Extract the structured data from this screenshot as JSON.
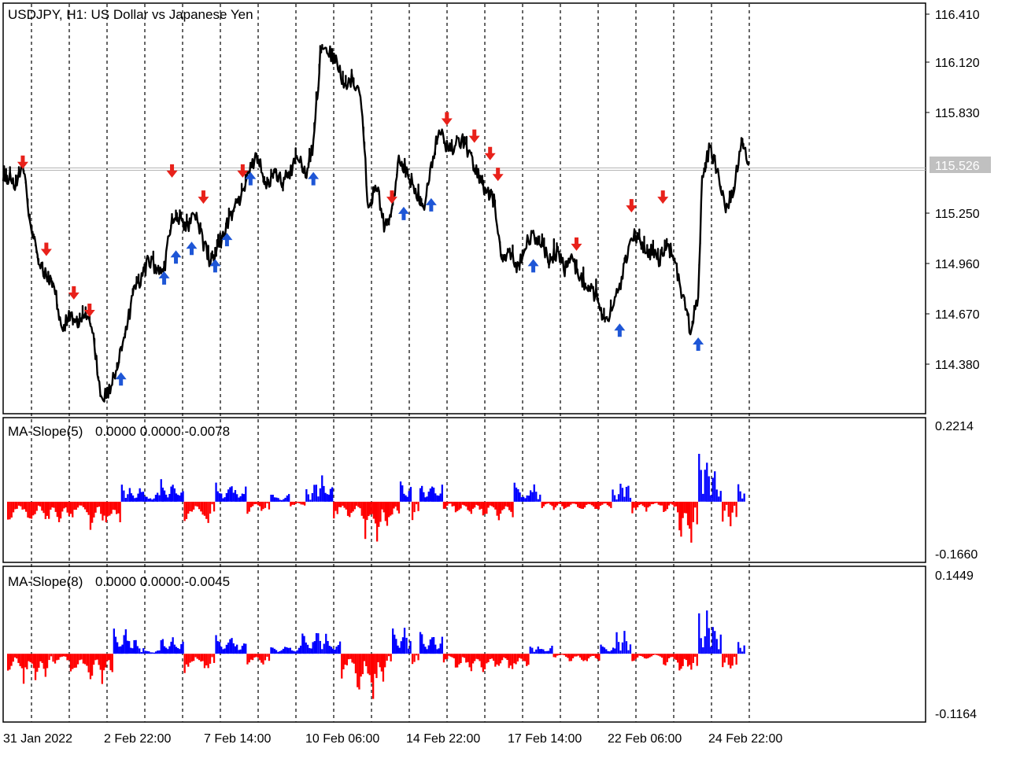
{
  "chart_data": {
    "type": "line",
    "title": "USDJPY, H1:  US Dollar vs  Japanese Yen",
    "x_tick_labels": [
      "31 Jan 2022",
      "2 Feb 22:00",
      "7 Feb 14:00",
      "10 Feb 06:00",
      "14 Feb 22:00",
      "17 Feb 14:00",
      "22 Feb 06:00",
      "24 Feb 22:00"
    ],
    "x_range": [
      0,
      190
    ],
    "price_panel": {
      "y_tick_labels": [
        "116.410",
        "116.120",
        "115.830",
        "115.250",
        "114.960",
        "114.670",
        "114.380"
      ],
      "ylim": [
        114.13,
        116.47
      ],
      "current_price": "115.526",
      "current_price_value": 115.526,
      "close": [
        [
          0,
          115.5
        ],
        [
          3,
          115.45
        ],
        [
          5,
          115.55
        ],
        [
          7,
          115.2
        ],
        [
          9,
          115.0
        ],
        [
          11,
          114.9
        ],
        [
          13,
          114.85
        ],
        [
          15,
          114.6
        ],
        [
          17,
          114.7
        ],
        [
          19,
          114.65
        ],
        [
          21,
          114.7
        ],
        [
          23,
          114.55
        ],
        [
          25,
          114.2
        ],
        [
          27,
          114.25
        ],
        [
          29,
          114.4
        ],
        [
          31,
          114.55
        ],
        [
          33,
          114.8
        ],
        [
          35,
          114.9
        ],
        [
          37,
          115.0
        ],
        [
          39,
          114.95
        ],
        [
          41,
          114.95
        ],
        [
          43,
          115.25
        ],
        [
          45,
          115.25
        ],
        [
          47,
          115.2
        ],
        [
          49,
          115.25
        ],
        [
          51,
          115.1
        ],
        [
          53,
          114.98
        ],
        [
          55,
          115.1
        ],
        [
          57,
          115.2
        ],
        [
          59,
          115.3
        ],
        [
          61,
          115.4
        ],
        [
          63,
          115.55
        ],
        [
          65,
          115.6
        ],
        [
          67,
          115.4
        ],
        [
          69,
          115.5
        ],
        [
          71,
          115.45
        ],
        [
          73,
          115.5
        ],
        [
          75,
          115.6
        ],
        [
          77,
          115.5
        ],
        [
          79,
          115.65
        ],
        [
          81,
          116.25
        ],
        [
          83,
          116.2
        ],
        [
          85,
          116.15
        ],
        [
          87,
          116.0
        ],
        [
          89,
          116.05
        ],
        [
          91,
          115.95
        ],
        [
          93,
          115.3
        ],
        [
          95,
          115.45
        ],
        [
          97,
          115.2
        ],
        [
          99,
          115.3
        ],
        [
          101,
          115.6
        ],
        [
          103,
          115.5
        ],
        [
          105,
          115.4
        ],
        [
          107,
          115.3
        ],
        [
          109,
          115.55
        ],
        [
          111,
          115.75
        ],
        [
          113,
          115.65
        ],
        [
          115,
          115.65
        ],
        [
          117,
          115.7
        ],
        [
          119,
          115.6
        ],
        [
          121,
          115.5
        ],
        [
          123,
          115.4
        ],
        [
          125,
          115.35
        ],
        [
          127,
          115.0
        ],
        [
          129,
          115.05
        ],
        [
          131,
          114.95
        ],
        [
          133,
          115.1
        ],
        [
          135,
          115.15
        ],
        [
          137,
          115.1
        ],
        [
          139,
          115.0
        ],
        [
          141,
          115.05
        ],
        [
          143,
          114.95
        ],
        [
          145,
          115.0
        ],
        [
          147,
          114.9
        ],
        [
          149,
          114.85
        ],
        [
          151,
          114.8
        ],
        [
          153,
          114.65
        ],
        [
          155,
          114.7
        ],
        [
          157,
          114.85
        ],
        [
          159,
          115.05
        ],
        [
          161,
          115.15
        ],
        [
          163,
          115.05
        ],
        [
          165,
          115.05
        ],
        [
          167,
          115.0
        ],
        [
          169,
          115.1
        ],
        [
          171,
          115.0
        ],
        [
          173,
          114.8
        ],
        [
          175,
          114.6
        ],
        [
          177,
          114.8
        ],
        [
          178,
          115.5
        ],
        [
          180,
          115.65
        ],
        [
          182,
          115.5
        ],
        [
          184,
          115.3
        ],
        [
          186,
          115.4
        ],
        [
          188,
          115.7
        ],
        [
          190,
          115.55
        ]
      ],
      "sell_signals": [
        [
          5,
          115.45
        ],
        [
          11,
          114.95
        ],
        [
          18,
          114.7
        ],
        [
          22,
          114.6
        ],
        [
          43,
          115.4
        ],
        [
          51,
          115.25
        ],
        [
          61,
          115.4
        ],
        [
          99,
          115.25
        ],
        [
          113,
          115.7
        ],
        [
          120,
          115.6
        ],
        [
          124,
          115.5
        ],
        [
          126,
          115.38
        ],
        [
          146,
          114.98
        ],
        [
          160,
          115.2
        ],
        [
          168,
          115.25
        ]
      ],
      "buy_signals": [
        [
          30,
          114.4
        ],
        [
          41,
          114.98
        ],
        [
          44,
          115.1
        ],
        [
          48,
          115.15
        ],
        [
          54,
          115.05
        ],
        [
          57,
          115.2
        ],
        [
          63,
          115.55
        ],
        [
          79,
          115.55
        ],
        [
          102,
          115.35
        ],
        [
          109,
          115.4
        ],
        [
          135,
          115.05
        ],
        [
          157,
          114.68
        ],
        [
          177,
          114.6
        ]
      ]
    },
    "indicators": [
      {
        "name": "MA-Slope(5)",
        "values_text": "0.0000 0.0000 -0.0078",
        "y_tick_labels": [
          "0.2214",
          "-0.1660"
        ],
        "ylim": [
          -0.166,
          0.2214
        ],
        "peaks": [
          [
            1,
            -0.03
          ],
          [
            7,
            -0.07
          ],
          [
            11,
            -0.04
          ],
          [
            14,
            -0.07
          ],
          [
            17,
            0.01
          ],
          [
            22,
            -0.06
          ],
          [
            26,
            -0.09
          ],
          [
            30,
            0.03
          ],
          [
            32,
            0.06
          ],
          [
            35,
            -0.01
          ],
          [
            40,
            0.04
          ],
          [
            43,
            0.07
          ],
          [
            46,
            -0.03
          ],
          [
            52,
            -0.07
          ],
          [
            54,
            0.02
          ],
          [
            58,
            0.06
          ],
          [
            62,
            0.04
          ],
          [
            66,
            -0.04
          ],
          [
            68,
            0.03
          ],
          [
            73,
            -0.02
          ],
          [
            77,
            0.01
          ],
          [
            79,
            0.05
          ],
          [
            81,
            0.09
          ],
          [
            84,
            -0.06
          ],
          [
            88,
            -0.02
          ],
          [
            92,
            -0.07
          ],
          [
            95,
            -0.13
          ],
          [
            98,
            -0.08
          ],
          [
            101,
            0.07
          ],
          [
            104,
            -0.06
          ],
          [
            106,
            -0.02
          ],
          [
            109,
            0.07
          ],
          [
            112,
            -0.03
          ],
          [
            115,
            0.01
          ],
          [
            119,
            -0.05
          ],
          [
            122,
            0.01
          ],
          [
            126,
            -0.06
          ],
          [
            130,
            -0.05
          ],
          [
            135,
            0.06
          ],
          [
            137,
            0.02
          ],
          [
            140,
            -0.02
          ],
          [
            143,
            -0.03
          ],
          [
            147,
            -0.01
          ],
          [
            151,
            -0.03
          ],
          [
            155,
            0.01
          ],
          [
            157,
            0.05
          ],
          [
            159,
            0.08
          ],
          [
            160,
            -0.04
          ],
          [
            164,
            -0.01
          ],
          [
            168,
            -0.02
          ],
          [
            172,
            -0.04
          ],
          [
            175,
            -0.15
          ],
          [
            177,
            0.06
          ],
          [
            179,
            0.18
          ],
          [
            181,
            0.1
          ],
          [
            183,
            -0.05
          ],
          [
            185,
            -0.08
          ],
          [
            187,
            0.06
          ],
          [
            189,
            0.04
          ]
        ]
      },
      {
        "name": "MA-Slope(8)",
        "values_text": "0.0000 0.0000 -0.0045",
        "y_tick_labels": [
          "0.1449",
          "-0.1164"
        ],
        "ylim": [
          -0.1164,
          0.1449
        ],
        "peaks": [
          [
            1,
            0.02
          ],
          [
            5,
            -0.04
          ],
          [
            8,
            -0.06
          ],
          [
            11,
            -0.03
          ],
          [
            13,
            -0.02
          ],
          [
            17,
            0.01
          ],
          [
            22,
            -0.05
          ],
          [
            25,
            -0.06
          ],
          [
            28,
            0.02
          ],
          [
            31,
            0.05
          ],
          [
            34,
            0.02
          ],
          [
            36,
            -0.01
          ],
          [
            40,
            0.01
          ],
          [
            43,
            0.04
          ],
          [
            46,
            0.03
          ],
          [
            52,
            -0.04
          ],
          [
            54,
            0.01
          ],
          [
            58,
            0.04
          ],
          [
            62,
            0.03
          ],
          [
            66,
            -0.03
          ],
          [
            68,
            0.02
          ],
          [
            72,
            0.01
          ],
          [
            76,
            0.02
          ],
          [
            80,
            0.05
          ],
          [
            82,
            0.04
          ],
          [
            86,
            -0.02
          ],
          [
            90,
            -0.05
          ],
          [
            94,
            -0.09
          ],
          [
            97,
            -0.03
          ],
          [
            99,
            0.02
          ],
          [
            102,
            0.06
          ],
          [
            104,
            -0.03
          ],
          [
            106,
            -0.02
          ],
          [
            109,
            0.05
          ],
          [
            112,
            -0.02
          ],
          [
            115,
            0.01
          ],
          [
            119,
            -0.04
          ],
          [
            122,
            0.01
          ],
          [
            126,
            -0.04
          ],
          [
            129,
            -0.04
          ],
          [
            134,
            0.02
          ],
          [
            136,
            0.02
          ],
          [
            140,
            -0.01
          ],
          [
            144,
            -0.01
          ],
          [
            148,
            -0.02
          ],
          [
            152,
            -0.01
          ],
          [
            156,
            0.02
          ],
          [
            158,
            0.05
          ],
          [
            160,
            -0.02
          ],
          [
            164,
            0.01
          ],
          [
            168,
            -0.01
          ],
          [
            172,
            -0.03
          ],
          [
            175,
            -0.05
          ],
          [
            177,
            0.04
          ],
          [
            179,
            0.09
          ],
          [
            181,
            0.07
          ],
          [
            183,
            -0.02
          ],
          [
            185,
            -0.04
          ],
          [
            187,
            0.03
          ],
          [
            189,
            0.03
          ]
        ]
      }
    ],
    "colors": {
      "price": "#000000",
      "positive": "#0000ff",
      "negative": "#ff0000",
      "buy_arrow": "#1e56d6",
      "sell_arrow": "#e8211a",
      "grid": "#000000",
      "price_label_bg": "#c0c0c0"
    }
  }
}
